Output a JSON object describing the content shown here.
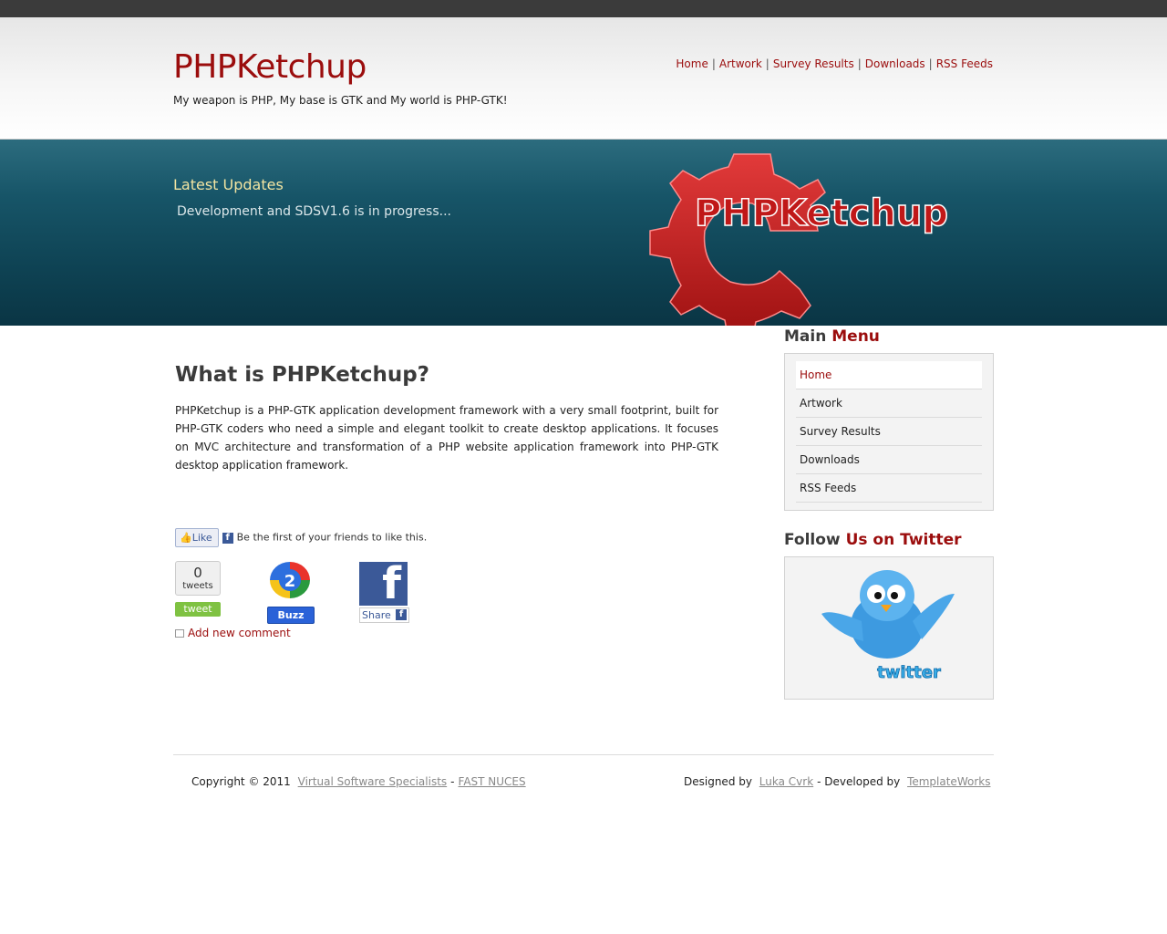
{
  "header": {
    "site_title": "PHPKetchup",
    "tagline": "My weapon is PHP, My base is GTK and My world is PHP-GTK!",
    "nav": [
      "Home",
      "Artwork",
      "Survey Results",
      "Downloads",
      "RSS Feeds"
    ],
    "nav_separator": "|"
  },
  "banner": {
    "updates_title": "Latest Updates",
    "updates_text": "Development and SDSV1.6 is in progress...",
    "logo_text": "PHPKetchup"
  },
  "main": {
    "heading": "What is PHPKetchup?",
    "body": "PHPKetchup is a PHP-GTK application development framework with a very small footprint, built for PHP-GTK coders who need a simple and elegant toolkit to create desktop applications. It focuses on MVC architecture and transformation of a PHP website application framework into PHP-GTK desktop application framework."
  },
  "social": {
    "like_label": "Like",
    "like_text": "Be the first of your friends to like this.",
    "tweet_count": "0",
    "tweet_count_label": "tweets",
    "tweet_button": "tweet",
    "buzz_count": "2",
    "buzz_button": "Buzz",
    "share_button": "Share",
    "add_comment": "Add new comment"
  },
  "sidebar": {
    "menu_title_a": "Main",
    "menu_title_b": "Menu",
    "menu_items": [
      "Home",
      "Artwork",
      "Survey Results",
      "Downloads",
      "RSS Feeds"
    ],
    "twitter_title_a": "Follow",
    "twitter_title_b": "Us on Twitter",
    "twitter_logo_text": "twitter"
  },
  "footer": {
    "copyright": "Copyright © 2011",
    "link1": "Virtual Software Specialists",
    "dash": "-",
    "link2": "FAST NUCES",
    "designed_by": "Designed by",
    "designer": "Luka Cvrk",
    "developed_by": "- Developed by",
    "developer": "TemplateWorks"
  },
  "colors": {
    "brand_red": "#9b0d0d",
    "banner_teal": "#0e4253",
    "topbar": "#3b3b3b"
  }
}
